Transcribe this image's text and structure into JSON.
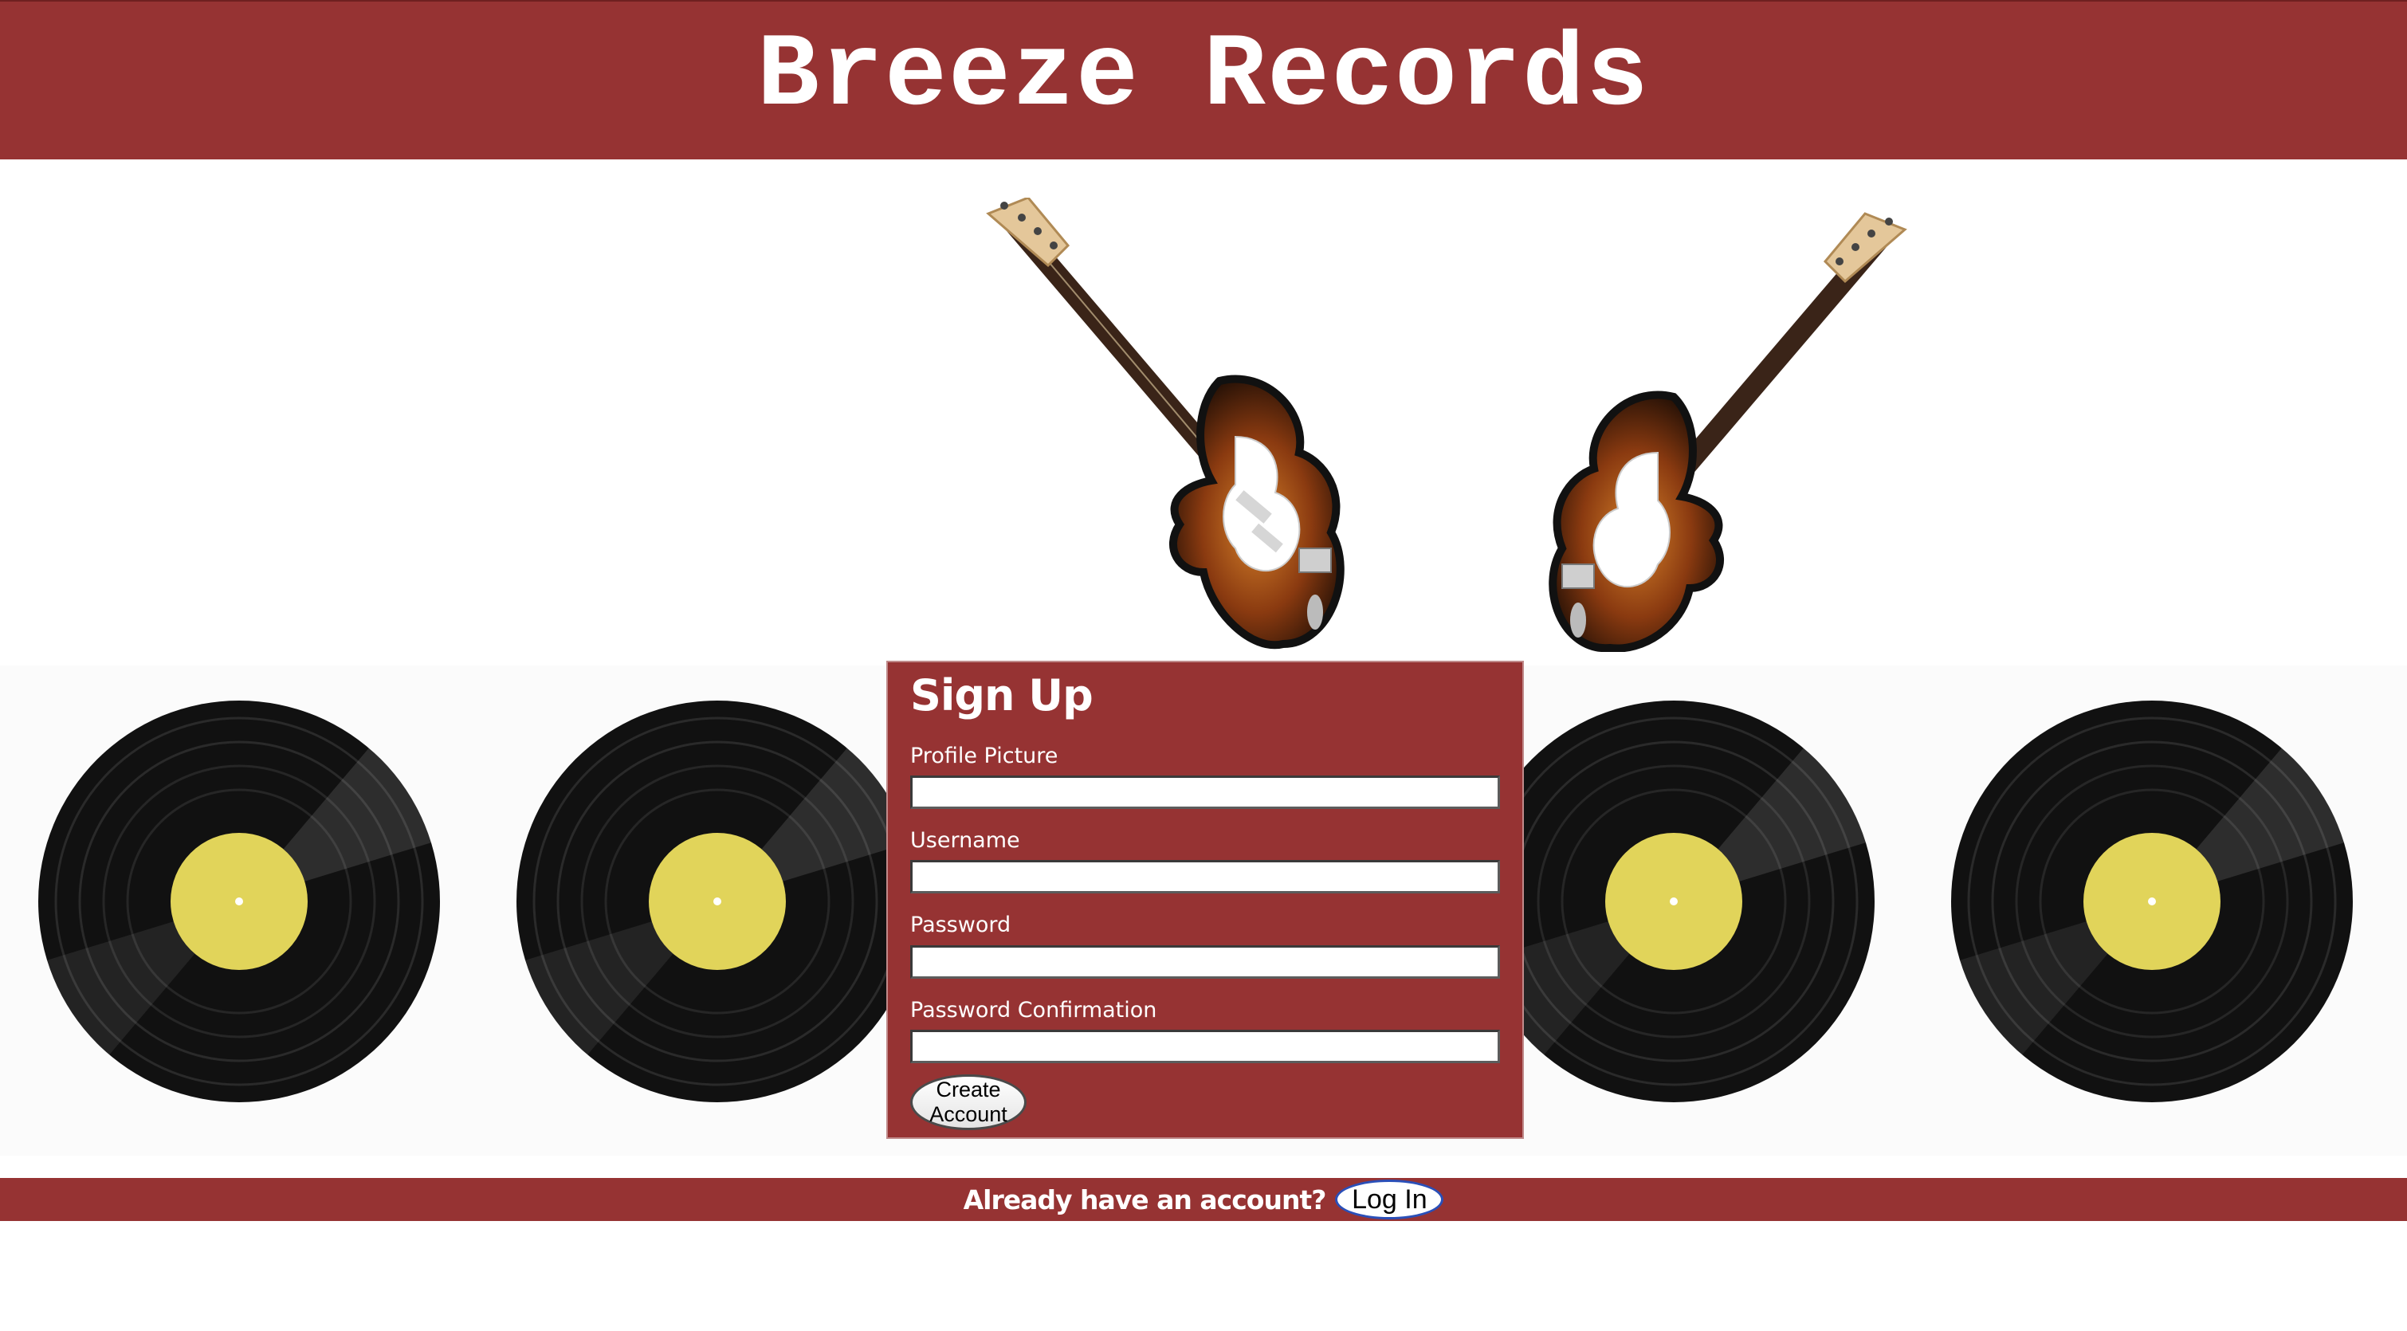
{
  "header": {
    "title": "Breeze Records"
  },
  "images": {
    "guitars": "guitar-pair-image",
    "records": [
      "vinyl-record-1",
      "vinyl-record-2",
      "vinyl-record-3",
      "vinyl-record-4"
    ]
  },
  "signup": {
    "title": "Sign Up",
    "fields": [
      {
        "label": "Profile Picture",
        "value": ""
      },
      {
        "label": "Username",
        "value": ""
      },
      {
        "label": "Password",
        "value": ""
      },
      {
        "label": "Password Confirmation",
        "value": ""
      }
    ],
    "submit_label": "Create Account"
  },
  "footer": {
    "prompt": "Already have an account?",
    "login_label": "Log In"
  },
  "colors": {
    "brand": "#963333",
    "record_label": "#e1d45a",
    "login_border": "#2a4fb8"
  }
}
